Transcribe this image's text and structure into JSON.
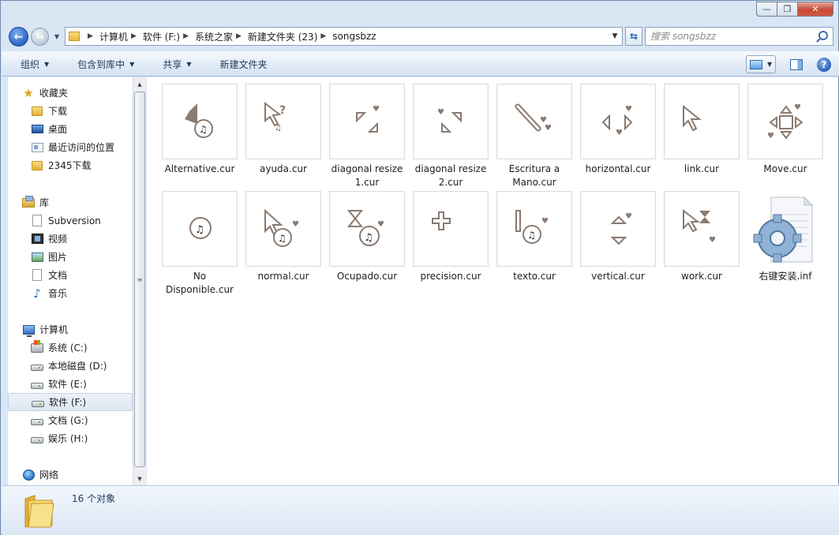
{
  "window": {
    "controls": {
      "minimize": "—",
      "maximize": "❐",
      "close": "✕"
    }
  },
  "nav": {
    "back_glyph": "←",
    "forward_glyph": "→",
    "breadcrumb": [
      "计算机",
      "软件 (F:)",
      "系统之家",
      "新建文件夹 (23)",
      "songsbzz"
    ],
    "search_placeholder": "搜索 songsbzz"
  },
  "toolbar": {
    "organize": "组织",
    "include_in_library": "包含到库中",
    "share": "共享",
    "new_folder": "新建文件夹",
    "help": "?"
  },
  "sidebar": {
    "favorites": {
      "label": "收藏夹",
      "items": [
        "下载",
        "桌面",
        "最近访问的位置",
        "2345下载"
      ]
    },
    "libraries": {
      "label": "库",
      "items": [
        "Subversion",
        "视频",
        "图片",
        "文档",
        "音乐"
      ]
    },
    "computer": {
      "label": "计算机",
      "items": [
        "系统 (C:)",
        "本地磁盘 (D:)",
        "软件 (E:)",
        "软件 (F:)",
        "文档 (G:)",
        "娱乐 (H:)"
      ]
    },
    "network": {
      "label": "网络"
    }
  },
  "files": [
    {
      "name": "Alternative.cur",
      "icon": "cursor-alternative-icon"
    },
    {
      "name": "ayuda.cur",
      "icon": "cursor-help-icon"
    },
    {
      "name": "diagonal resize 1.cur",
      "icon": "cursor-diag1-icon"
    },
    {
      "name": "diagonal resize 2.cur",
      "icon": "cursor-diag2-icon"
    },
    {
      "name": "Escritura a Mano.cur",
      "icon": "cursor-pen-icon"
    },
    {
      "name": "horizontal.cur",
      "icon": "cursor-horizontal-icon"
    },
    {
      "name": "link.cur",
      "icon": "cursor-link-icon"
    },
    {
      "name": "Move.cur",
      "icon": "cursor-move-icon"
    },
    {
      "name": "No Disponible.cur",
      "icon": "cursor-unavailable-icon"
    },
    {
      "name": "normal.cur",
      "icon": "cursor-normal-icon"
    },
    {
      "name": "Ocupado.cur",
      "icon": "cursor-busy-icon"
    },
    {
      "name": "precision.cur",
      "icon": "cursor-precision-icon"
    },
    {
      "name": "texto.cur",
      "icon": "cursor-text-icon"
    },
    {
      "name": "vertical.cur",
      "icon": "cursor-vertical-icon"
    },
    {
      "name": "work.cur",
      "icon": "cursor-work-icon"
    },
    {
      "name": "右键安装.inf",
      "icon": "settings-gear-file-icon"
    }
  ],
  "status": {
    "count_text": "16 个对象"
  },
  "colors": {
    "accent": "#2a63c3",
    "text": "#1e1e1e",
    "cursor_brown": "#8a7a70"
  }
}
